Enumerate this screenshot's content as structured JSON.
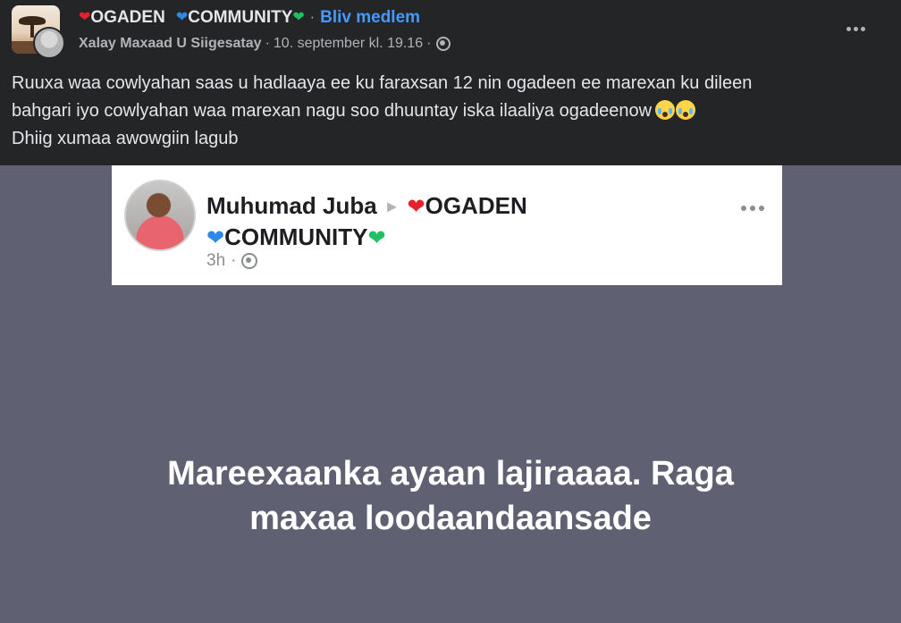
{
  "header": {
    "group_name_part1": "OGADEN",
    "group_name_part2": "COMMUNITY",
    "separator": "·",
    "join_label": "Bliv medlem",
    "author": "Xalay Maxaad U Siigesatay",
    "meta_separator_1": "·",
    "timestamp": "10. september kl. 19.16",
    "meta_separator_2": "·",
    "more_icon": "ellipsis-icon",
    "privacy_icon": "globe-icon"
  },
  "post": {
    "lines": [
      "Ruuxa waa cowlyahan saas u hadlaaya ee ku faraxsan 12 nin ogadeen ee marexan ku dileen",
      "bahgari iyo cowlyahan waa marexan nagu soo dhuuntay iska ilaaliya ogadeenow",
      "Dhiig xumaa awowgiin lagub"
    ],
    "emoji_icon": "crying-face-icon"
  },
  "embedded_post": {
    "author": "Muhumad Juba",
    "group_part1": "OGADEN",
    "group_part2": "COMMUNITY",
    "time": "3h",
    "time_separator": "·",
    "arrow_icon": "triangle-right-icon",
    "privacy_icon": "globe-icon",
    "more_icon": "ellipsis-icon"
  },
  "image_text": {
    "line1": "Mareexaanka ayaan lajiraaaa. Raga",
    "line2": "maxaa loodaandaansade"
  },
  "colors": {
    "background": "#242526",
    "link": "#4599ff",
    "media_background": "#5f6172",
    "heart_red": "#e8202e",
    "heart_blue": "#2d88e8",
    "heart_green": "#21c063"
  }
}
